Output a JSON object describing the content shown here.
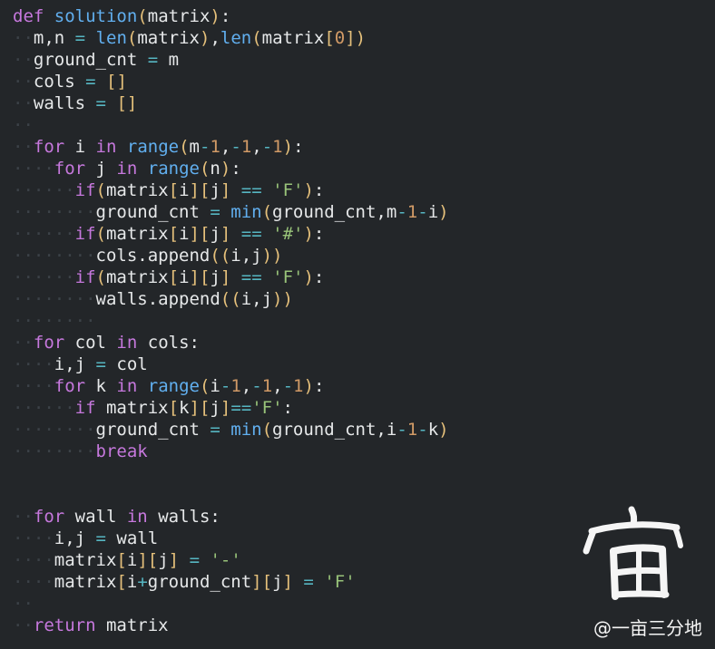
{
  "editor": {
    "lines": [
      [
        {
          "t": "def",
          "c": "kw"
        },
        {
          "t": " "
        },
        {
          "t": "solution",
          "c": "fn"
        },
        {
          "t": "(",
          "c": "br"
        },
        {
          "t": "matrix"
        },
        {
          "t": ")",
          "c": "br"
        },
        {
          "t": ":"
        }
      ],
      [
        {
          "t": "··",
          "c": "ws"
        },
        {
          "t": "m,n "
        },
        {
          "t": "=",
          "c": "op"
        },
        {
          "t": " "
        },
        {
          "t": "len",
          "c": "fn"
        },
        {
          "t": "(",
          "c": "br"
        },
        {
          "t": "matrix"
        },
        {
          "t": ")",
          "c": "br"
        },
        {
          "t": ","
        },
        {
          "t": "len",
          "c": "fn"
        },
        {
          "t": "(",
          "c": "br"
        },
        {
          "t": "matrix"
        },
        {
          "t": "[",
          "c": "br"
        },
        {
          "t": "0",
          "c": "num"
        },
        {
          "t": "]",
          "c": "br"
        },
        {
          "t": ")",
          "c": "br"
        }
      ],
      [
        {
          "t": "··",
          "c": "ws"
        },
        {
          "t": "ground_cnt "
        },
        {
          "t": "=",
          "c": "op"
        },
        {
          "t": " m"
        }
      ],
      [
        {
          "t": "··",
          "c": "ws"
        },
        {
          "t": "cols "
        },
        {
          "t": "=",
          "c": "op"
        },
        {
          "t": " "
        },
        {
          "t": "[]",
          "c": "br"
        }
      ],
      [
        {
          "t": "··",
          "c": "ws"
        },
        {
          "t": "walls "
        },
        {
          "t": "=",
          "c": "op"
        },
        {
          "t": " "
        },
        {
          "t": "[]",
          "c": "br"
        }
      ],
      [
        {
          "t": "··",
          "c": "ws"
        }
      ],
      [
        {
          "t": "··",
          "c": "ws"
        },
        {
          "t": "for",
          "c": "kw"
        },
        {
          "t": " i "
        },
        {
          "t": "in",
          "c": "kw"
        },
        {
          "t": " "
        },
        {
          "t": "range",
          "c": "fn"
        },
        {
          "t": "(",
          "c": "br"
        },
        {
          "t": "m"
        },
        {
          "t": "-",
          "c": "op"
        },
        {
          "t": "1",
          "c": "num"
        },
        {
          "t": ","
        },
        {
          "t": "-",
          "c": "op"
        },
        {
          "t": "1",
          "c": "num"
        },
        {
          "t": ","
        },
        {
          "t": "-",
          "c": "op"
        },
        {
          "t": "1",
          "c": "num"
        },
        {
          "t": ")",
          "c": "br"
        },
        {
          "t": ":"
        }
      ],
      [
        {
          "t": "····",
          "c": "ws"
        },
        {
          "t": "for",
          "c": "kw"
        },
        {
          "t": " j "
        },
        {
          "t": "in",
          "c": "kw"
        },
        {
          "t": " "
        },
        {
          "t": "range",
          "c": "fn"
        },
        {
          "t": "(",
          "c": "br"
        },
        {
          "t": "n"
        },
        {
          "t": ")",
          "c": "br"
        },
        {
          "t": ":"
        }
      ],
      [
        {
          "t": "······",
          "c": "ws"
        },
        {
          "t": "if",
          "c": "kw"
        },
        {
          "t": "(",
          "c": "br"
        },
        {
          "t": "matrix"
        },
        {
          "t": "[",
          "c": "br"
        },
        {
          "t": "i"
        },
        {
          "t": "]",
          "c": "br"
        },
        {
          "t": "[",
          "c": "br"
        },
        {
          "t": "j"
        },
        {
          "t": "]",
          "c": "br"
        },
        {
          "t": " "
        },
        {
          "t": "==",
          "c": "op"
        },
        {
          "t": " "
        },
        {
          "t": "'F'",
          "c": "str"
        },
        {
          "t": ")",
          "c": "br"
        },
        {
          "t": ":"
        }
      ],
      [
        {
          "t": "········",
          "c": "ws"
        },
        {
          "t": "ground_cnt "
        },
        {
          "t": "=",
          "c": "op"
        },
        {
          "t": " "
        },
        {
          "t": "min",
          "c": "fn"
        },
        {
          "t": "(",
          "c": "br"
        },
        {
          "t": "ground_cnt,m"
        },
        {
          "t": "-",
          "c": "op"
        },
        {
          "t": "1",
          "c": "num"
        },
        {
          "t": "-",
          "c": "op"
        },
        {
          "t": "i"
        },
        {
          "t": ")",
          "c": "br"
        }
      ],
      [
        {
          "t": "······",
          "c": "ws"
        },
        {
          "t": "if",
          "c": "kw"
        },
        {
          "t": "(",
          "c": "br"
        },
        {
          "t": "matrix"
        },
        {
          "t": "[",
          "c": "br"
        },
        {
          "t": "i"
        },
        {
          "t": "]",
          "c": "br"
        },
        {
          "t": "[",
          "c": "br"
        },
        {
          "t": "j"
        },
        {
          "t": "]",
          "c": "br"
        },
        {
          "t": " "
        },
        {
          "t": "==",
          "c": "op"
        },
        {
          "t": " "
        },
        {
          "t": "'#'",
          "c": "str"
        },
        {
          "t": ")",
          "c": "br"
        },
        {
          "t": ":"
        }
      ],
      [
        {
          "t": "········",
          "c": "ws"
        },
        {
          "t": "cols.append"
        },
        {
          "t": "((",
          "c": "br"
        },
        {
          "t": "i,j"
        },
        {
          "t": "))",
          "c": "br"
        }
      ],
      [
        {
          "t": "······",
          "c": "ws"
        },
        {
          "t": "if",
          "c": "kw"
        },
        {
          "t": "(",
          "c": "br"
        },
        {
          "t": "matrix"
        },
        {
          "t": "[",
          "c": "br"
        },
        {
          "t": "i"
        },
        {
          "t": "]",
          "c": "br"
        },
        {
          "t": "[",
          "c": "br"
        },
        {
          "t": "j"
        },
        {
          "t": "]",
          "c": "br"
        },
        {
          "t": " "
        },
        {
          "t": "==",
          "c": "op"
        },
        {
          "t": " "
        },
        {
          "t": "'F'",
          "c": "str"
        },
        {
          "t": ")",
          "c": "br"
        },
        {
          "t": ":"
        }
      ],
      [
        {
          "t": "········",
          "c": "ws"
        },
        {
          "t": "walls.append"
        },
        {
          "t": "((",
          "c": "br"
        },
        {
          "t": "i,j"
        },
        {
          "t": "))",
          "c": "br"
        }
      ],
      [
        {
          "t": "········",
          "c": "ws"
        }
      ],
      [
        {
          "t": "··",
          "c": "ws"
        },
        {
          "t": "for",
          "c": "kw"
        },
        {
          "t": " col "
        },
        {
          "t": "in",
          "c": "kw"
        },
        {
          "t": " cols:"
        }
      ],
      [
        {
          "t": "····",
          "c": "ws"
        },
        {
          "t": "i,j "
        },
        {
          "t": "=",
          "c": "op"
        },
        {
          "t": " col"
        }
      ],
      [
        {
          "t": "····",
          "c": "ws"
        },
        {
          "t": "for",
          "c": "kw"
        },
        {
          "t": " k "
        },
        {
          "t": "in",
          "c": "kw"
        },
        {
          "t": " "
        },
        {
          "t": "range",
          "c": "fn"
        },
        {
          "t": "(",
          "c": "br"
        },
        {
          "t": "i"
        },
        {
          "t": "-",
          "c": "op"
        },
        {
          "t": "1",
          "c": "num"
        },
        {
          "t": ","
        },
        {
          "t": "-",
          "c": "op"
        },
        {
          "t": "1",
          "c": "num"
        },
        {
          "t": ","
        },
        {
          "t": "-",
          "c": "op"
        },
        {
          "t": "1",
          "c": "num"
        },
        {
          "t": ")",
          "c": "br"
        },
        {
          "t": ":"
        }
      ],
      [
        {
          "t": "······",
          "c": "ws"
        },
        {
          "t": "if",
          "c": "kw"
        },
        {
          "t": " matrix"
        },
        {
          "t": "[",
          "c": "br"
        },
        {
          "t": "k"
        },
        {
          "t": "]",
          "c": "br"
        },
        {
          "t": "[",
          "c": "br"
        },
        {
          "t": "j"
        },
        {
          "t": "]",
          "c": "br"
        },
        {
          "t": "==",
          "c": "op"
        },
        {
          "t": "'F'",
          "c": "str"
        },
        {
          "t": ":"
        }
      ],
      [
        {
          "t": "········",
          "c": "ws"
        },
        {
          "t": "ground_cnt "
        },
        {
          "t": "=",
          "c": "op"
        },
        {
          "t": " "
        },
        {
          "t": "min",
          "c": "fn"
        },
        {
          "t": "(",
          "c": "br"
        },
        {
          "t": "ground_cnt,i"
        },
        {
          "t": "-",
          "c": "op"
        },
        {
          "t": "1",
          "c": "num"
        },
        {
          "t": "-",
          "c": "op"
        },
        {
          "t": "k"
        },
        {
          "t": ")",
          "c": "br"
        }
      ],
      [
        {
          "t": "········",
          "c": "ws"
        },
        {
          "t": "break",
          "c": "kw"
        }
      ],
      [
        {
          "t": ""
        }
      ],
      [
        {
          "t": ""
        }
      ],
      [
        {
          "t": "··",
          "c": "ws"
        },
        {
          "t": "for",
          "c": "kw"
        },
        {
          "t": " wall "
        },
        {
          "t": "in",
          "c": "kw"
        },
        {
          "t": " walls:"
        }
      ],
      [
        {
          "t": "····",
          "c": "ws"
        },
        {
          "t": "i,j "
        },
        {
          "t": "=",
          "c": "op"
        },
        {
          "t": " wall"
        }
      ],
      [
        {
          "t": "····",
          "c": "ws"
        },
        {
          "t": "matrix"
        },
        {
          "t": "[",
          "c": "br"
        },
        {
          "t": "i"
        },
        {
          "t": "]",
          "c": "br"
        },
        {
          "t": "[",
          "c": "br"
        },
        {
          "t": "j"
        },
        {
          "t": "]",
          "c": "br"
        },
        {
          "t": " "
        },
        {
          "t": "=",
          "c": "op"
        },
        {
          "t": " "
        },
        {
          "t": "'-'",
          "c": "str"
        }
      ],
      [
        {
          "t": "····",
          "c": "ws"
        },
        {
          "t": "matrix"
        },
        {
          "t": "[",
          "c": "br"
        },
        {
          "t": "i"
        },
        {
          "t": "+",
          "c": "op"
        },
        {
          "t": "ground_cnt"
        },
        {
          "t": "]",
          "c": "br"
        },
        {
          "t": "[",
          "c": "br"
        },
        {
          "t": "j"
        },
        {
          "t": "]",
          "c": "br"
        },
        {
          "t": " "
        },
        {
          "t": "=",
          "c": "op"
        },
        {
          "t": " "
        },
        {
          "t": "'F'",
          "c": "str"
        }
      ],
      [
        {
          "t": "··",
          "c": "ws"
        }
      ],
      [
        {
          "t": "··",
          "c": "ws"
        },
        {
          "t": "return",
          "c": "kw"
        },
        {
          "t": " matrix"
        }
      ]
    ]
  },
  "watermark": {
    "glyph": "亩",
    "text": "@一亩三分地"
  },
  "colors": {
    "background": "#232629",
    "keyword": "#c678dd",
    "function": "#61afef",
    "number": "#d19a66",
    "operator": "#56b6c2",
    "string": "#98c379",
    "bracket": "#e5c07b",
    "whitespace_marker": "#3c4248"
  }
}
